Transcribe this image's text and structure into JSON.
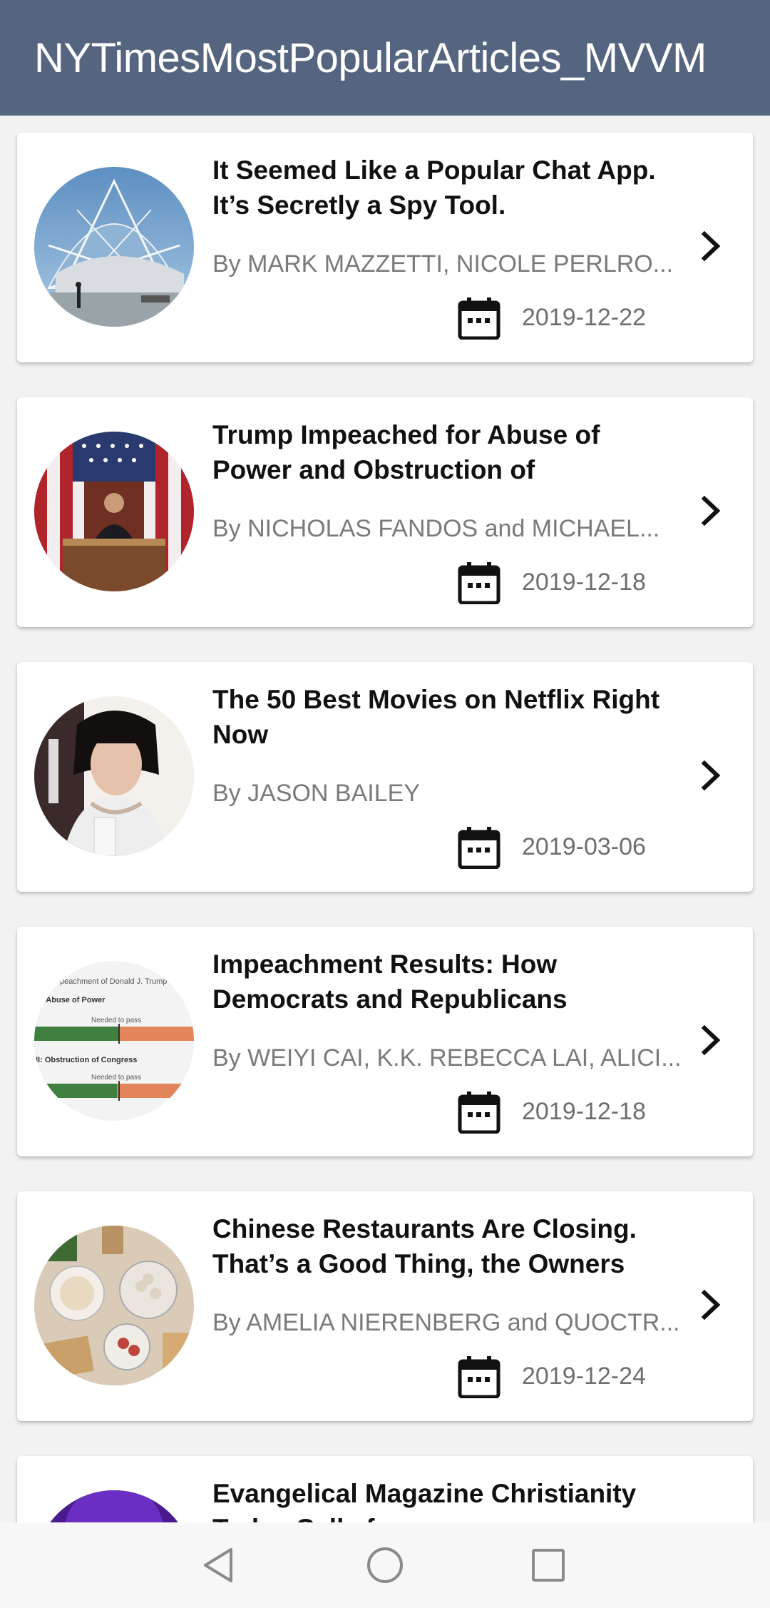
{
  "app": {
    "title": "NYTimesMostPopularArticles_MVVM"
  },
  "articles": [
    {
      "title": "It Seemed Like a Popular Chat App. It’s Secretly a Spy Tool.",
      "byline": "By MARK MAZZETTI, NICOLE PERLRO...",
      "date": "2019-12-22",
      "image": "architecture-dome-photo"
    },
    {
      "title": "Trump Impeached for Abuse of Power and Obstruction of",
      "byline": "By NICHOLAS FANDOS and MICHAEL...",
      "date": "2019-12-18",
      "image": "house-speaker-photo"
    },
    {
      "title": "The 50 Best Movies on Netflix Right Now",
      "byline": "By JASON BAILEY",
      "date": "2019-03-06",
      "image": "movie-still-photo"
    },
    {
      "title": "Impeachment Results: How Democrats and Republicans",
      "byline": "By WEIYI CAI, K.K. REBECCA LAI, ALICI...",
      "date": "2019-12-18",
      "image": "vote-results-graphic",
      "image_text": {
        "line1": "peachment of Donald J. Trump",
        "line2": ": Abuse of Power",
        "line3": "Needed to pass",
        "line4": "II: Obstruction of Congress",
        "line5": "Needed to pass"
      }
    },
    {
      "title": "Chinese Restaurants Are Closing. That’s a Good Thing, the Owners",
      "byline": "By AMELIA NIERENBERG and QUOCTR...",
      "date": "2019-12-24",
      "image": "food-dishes-photo"
    },
    {
      "title": "Evangelical Magazine Christianity Today Calls for",
      "byline": "",
      "date": "",
      "image": "purple-photo"
    }
  ],
  "icons": {
    "calendar": "calendar-icon",
    "chevron": "chevron-right-icon",
    "nav_back": "back-triangle-icon",
    "nav_home": "home-circle-icon",
    "nav_recents": "recents-square-icon"
  },
  "colors": {
    "appbar": "#56657f",
    "title_text": "#ffffff",
    "byline_text": "#7a7a7a",
    "background": "#f2f2f2"
  }
}
